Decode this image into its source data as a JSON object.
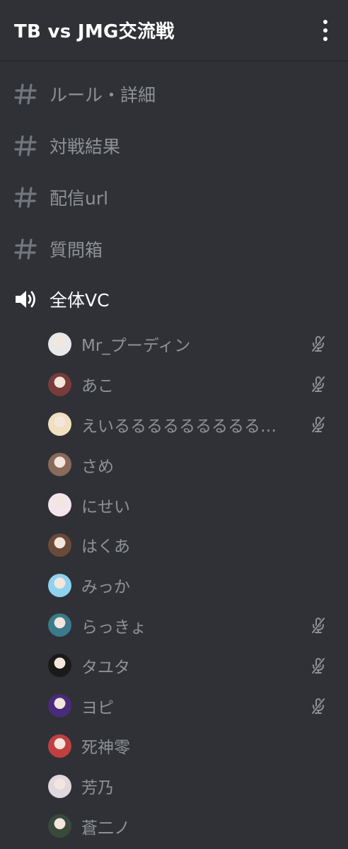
{
  "header": {
    "title": "TB vs JMG交流戦",
    "menu_icon": "more-vertical-icon"
  },
  "text_channels": [
    {
      "name": "ルール・詳細"
    },
    {
      "name": "対戦結果"
    },
    {
      "name": "配信url"
    },
    {
      "name": "質問箱"
    }
  ],
  "voice_channel": {
    "name": "全体VC",
    "icon": "speaker-icon"
  },
  "members": [
    {
      "name": "Mr_プーディン",
      "muted": true,
      "avatar": "#e8e8e8"
    },
    {
      "name": "あこ",
      "muted": true,
      "avatar": "#7a3b3b"
    },
    {
      "name": "えいるるるるるるるるるるる...",
      "muted": true,
      "avatar": "#f0e0c0"
    },
    {
      "name": "さめ",
      "muted": false,
      "avatar": "#8a6a5a"
    },
    {
      "name": "にせい",
      "muted": false,
      "avatar": "#f4e4ec"
    },
    {
      "name": "はくあ",
      "muted": false,
      "avatar": "#6b4a3a"
    },
    {
      "name": "みっか",
      "muted": false,
      "avatar": "#8fd2f0"
    },
    {
      "name": "らっきょ",
      "muted": true,
      "avatar": "#3a7a8a"
    },
    {
      "name": "タユタ",
      "muted": true,
      "avatar": "#1a1a1a"
    },
    {
      "name": "ヨピ",
      "muted": true,
      "avatar": "#4a2a7a"
    },
    {
      "name": "死神零",
      "muted": false,
      "avatar": "#c04040"
    },
    {
      "name": "芳乃",
      "muted": false,
      "avatar": "#e0d8e0"
    },
    {
      "name": "蒼二ノ",
      "muted": false,
      "avatar": "#3a4a3a"
    }
  ],
  "colors": {
    "background": "#2f3136",
    "channel_text": "#8e9297",
    "active_text": "#ffffff",
    "mute_icon": "#8e9297"
  }
}
